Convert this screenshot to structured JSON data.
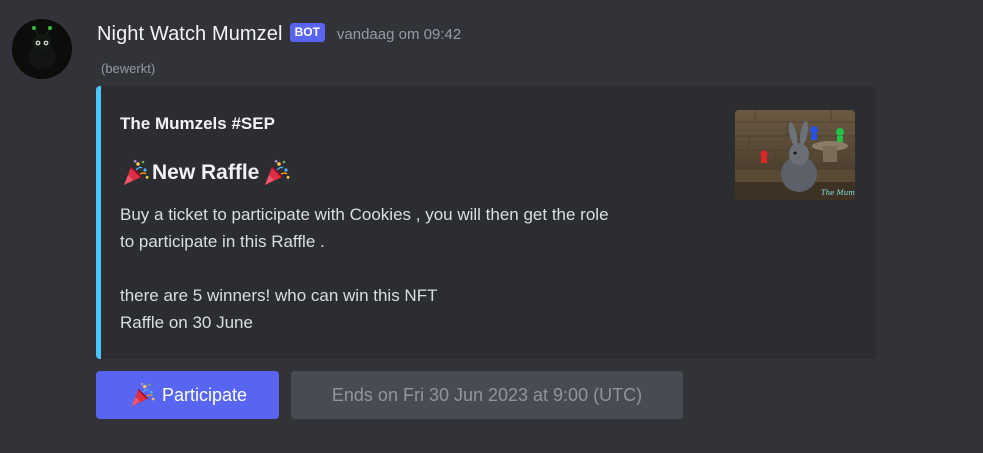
{
  "message": {
    "username": "Night Watch Mumzel",
    "bot_tag": "BOT",
    "timestamp": "vandaag om 09:42",
    "edited": "(bewerkt)"
  },
  "embed": {
    "accent_color": "#4cc6ff",
    "author": "The Mumzels #SEP",
    "title_emoji": "party-popper-icon",
    "title": "New Raffle",
    "description_lines": [
      "Buy a ticket to participate with Cookies , you will then get the role",
      "to participate in this Raffle .",
      "there are 5 winners! who can win this NFT",
      "Raffle on 30 June"
    ],
    "thumbnail_caption": "The Mumzels"
  },
  "buttons": {
    "participate": {
      "emoji": "party-popper-icon",
      "label": "Participate",
      "color": "#5865f2"
    },
    "ends": {
      "label": "Ends on Fri 30 Jun 2023 at 9:00 (UTC)",
      "disabled": true
    }
  }
}
